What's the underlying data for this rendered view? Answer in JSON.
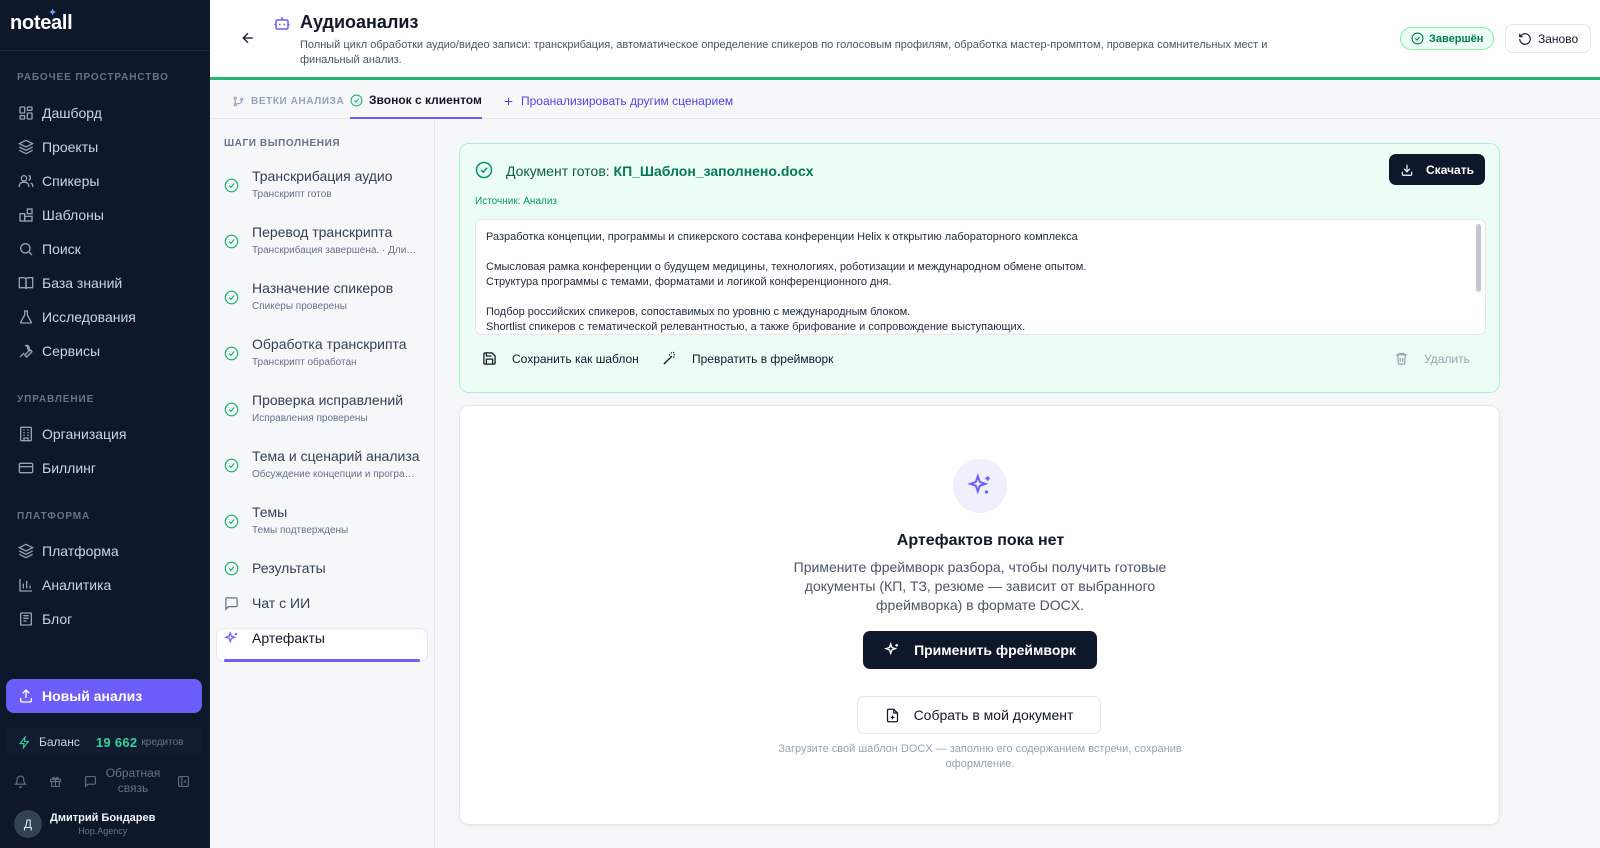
{
  "app": {
    "logo": "noteall"
  },
  "sidebar": {
    "section_workspace": "РАБОЧЕЕ ПРОСТРАНСТВО",
    "workspace_items": [
      {
        "label": "Дашборд",
        "icon": "dashboard-icon"
      },
      {
        "label": "Проекты",
        "icon": "layers-icon"
      },
      {
        "label": "Спикеры",
        "icon": "users-icon"
      },
      {
        "label": "Шаблоны",
        "icon": "blocks-icon"
      },
      {
        "label": "Поиск",
        "icon": "search-icon"
      },
      {
        "label": "База знаний",
        "icon": "book-icon"
      },
      {
        "label": "Исследования",
        "icon": "flask-icon"
      },
      {
        "label": "Сервисы",
        "icon": "wrench-icon"
      }
    ],
    "section_management": "УПРАВЛЕНИЕ",
    "management_items": [
      {
        "label": "Организация",
        "icon": "building-icon"
      },
      {
        "label": "Биллинг",
        "icon": "card-icon"
      }
    ],
    "section_platform": "ПЛАТФОРМА",
    "platform_items": [
      {
        "label": "Платформа",
        "icon": "layers-icon"
      },
      {
        "label": "Аналитика",
        "icon": "chart-icon"
      },
      {
        "label": "Блог",
        "icon": "newspaper-icon"
      }
    ],
    "new_analysis": "Новый анализ",
    "balance_label": "Баланс",
    "balance_value": "19 662",
    "balance_unit": "кредитов",
    "feedback": "Обратная связь",
    "user_initial": "Д",
    "user_name": "Дмитрий Бондарев",
    "user_org": "Hop.Agency"
  },
  "header": {
    "title": "Аудиоанализ",
    "subtitle": "Полный цикл обработки аудио/видео записи: транскрибация, автоматическое определение спикеров по голосовым профилям, обработка мастер-промптом, проверка сомнительных мест и финальный анализ.",
    "status": "Завершён",
    "restart": "Заново"
  },
  "tabs": {
    "branches": "ВЕТКИ АНАЛИЗА",
    "active": "Звонок с клиентом",
    "other": "Проанализировать другим сценарием"
  },
  "steps": {
    "heading": "ШАГИ ВЫПОЛНЕНИЯ",
    "items": [
      {
        "name": "Транскрибация аудио",
        "desc": "Транскрипт готов"
      },
      {
        "name": "Перевод транскрипта",
        "desc": "Транскрибация завершена. · Длительность записи"
      },
      {
        "name": "Назначение спикеров",
        "desc": "Спикеры проверены"
      },
      {
        "name": "Обработка транскрипта",
        "desc": "Транскрипт обработан"
      },
      {
        "name": "Проверка исправлений",
        "desc": "Исправления проверены"
      },
      {
        "name": "Тема и сценарий анализа",
        "desc": "Обсуждение концепции и программы конференции"
      },
      {
        "name": "Темы",
        "desc": "Темы подтверждены"
      },
      {
        "name": "Результаты",
        "desc": ""
      },
      {
        "name": "Чат с ИИ",
        "desc": ""
      },
      {
        "name": "Артефакты",
        "desc": ""
      }
    ]
  },
  "document": {
    "ready_label": "Документ готов:",
    "filename": "КП_Шаблон_заполнено.docx",
    "download": "Скачать",
    "source": "Источник: Анализ",
    "preview_lines": [
      "Разработка концепции, программы и спикерского состава конференции Helix к открытию лабораторного комплекса",
      "",
      "Смысловая рамка конференции о будущем медицины, технологиях, роботизации и международном обмене опытом.",
      "Структура программы с темами, форматами и логикой конференционного дня.",
      "",
      "Подбор российских спикеров, сопоставимых по уровню с международным блоком.",
      "Shortlist спикеров с тематической релевантностью, а также брифование и сопровождение выступающих."
    ],
    "save_template": "Сохранить как шаблон",
    "to_framework": "Превратить в фреймворк",
    "delete": "Удалить"
  },
  "artifacts": {
    "title": "Артефактов пока нет",
    "description": "Примените фреймворк разбора, чтобы получить готовые документы (КП, ТЗ, резюме — зависит от выбранного фреймворка) в формате DOCX.",
    "apply": "Применить фреймворк",
    "collect": "Собрать в мой документ",
    "hint": "Загрузите свой шаблон DOCX — заполню его содержанием встречи, сохранив оформление."
  },
  "colors": {
    "accent": "#6d5dfc",
    "success": "#22b573",
    "sidebar": "#0f172a"
  }
}
